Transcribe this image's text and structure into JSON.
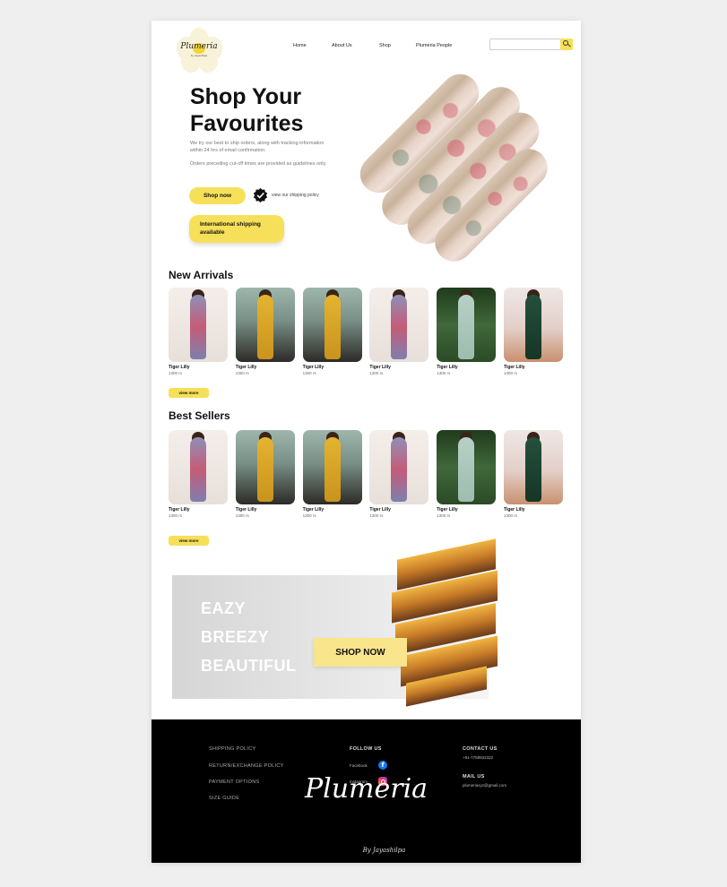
{
  "header": {
    "logo_text": "Plumeria",
    "logo_sub": "by Jayashilpa",
    "nav": [
      {
        "label": "Home"
      },
      {
        "label": "About Us"
      },
      {
        "label": "Shop"
      },
      {
        "label": "Plumeria People"
      }
    ],
    "search": {
      "value": ""
    }
  },
  "hero": {
    "title_line1": "Shop Your",
    "title_line2": "Favourites",
    "text1": "We try our best to ship orders, along with tracking information within 24 hrs of email confirmation.",
    "text2": "Orders preceding cut-off times are provided as guidelines only.",
    "shop_now": "Shop now",
    "view_shipping": "view our shipping policy",
    "international": "International shipping available"
  },
  "new_arrivals": {
    "title": "New Arrivals",
    "view_more": "view more",
    "products": [
      {
        "name": "Tiger Lilly",
        "price": "1300 rs"
      },
      {
        "name": "Tiger Lilly",
        "price": "1300 rs"
      },
      {
        "name": "Tiger Lilly",
        "price": "1300 rs"
      },
      {
        "name": "Tiger Lilly",
        "price": "1300 rs"
      },
      {
        "name": "Tiger Lilly",
        "price": "1300 rs"
      },
      {
        "name": "Tiger Lilly",
        "price": "1300 rs"
      }
    ]
  },
  "best_sellers": {
    "title": "Best Sellers",
    "view_more": "view more",
    "products": [
      {
        "name": "Tiger Lilly",
        "price": "1300 rs"
      },
      {
        "name": "Tiger Lilly",
        "price": "1300 rs"
      },
      {
        "name": "Tiger Lilly",
        "price": "1300 rs"
      },
      {
        "name": "Tiger Lilly",
        "price": "1300 rs"
      },
      {
        "name": "Tiger Lilly",
        "price": "1300 rs"
      },
      {
        "name": "Tiger Lilly",
        "price": "1300 rs"
      }
    ]
  },
  "promo": {
    "line1": "EAZY",
    "line2": "BREEZY",
    "line3": "BEAUTIFUL",
    "button": "SHOP NOW"
  },
  "footer": {
    "links": [
      "SHIPPING POLICY",
      "RETURN/EXCHANGE POLICY",
      "PAYMENT OPTIONS",
      "SIZE GUIDE"
    ],
    "follow_title": "FOLLOW US",
    "facebook": "Facebook",
    "instagram": "Instagram",
    "contact_title": "CONTACT US",
    "phone": "+91-7758932322",
    "mail_title": "MAIL US",
    "email": "plumeriaxyz@gmail.com",
    "brand": "Plumeria",
    "brand_sub": "By Jayashilpa"
  },
  "colors": {
    "accent_yellow": "#f6e05a",
    "footer_bg": "#000000",
    "page_bg": "#efefef"
  },
  "icons": {
    "search": "search-icon",
    "verified": "verified-badge-icon",
    "facebook": "facebook-icon",
    "instagram": "instagram-icon"
  }
}
